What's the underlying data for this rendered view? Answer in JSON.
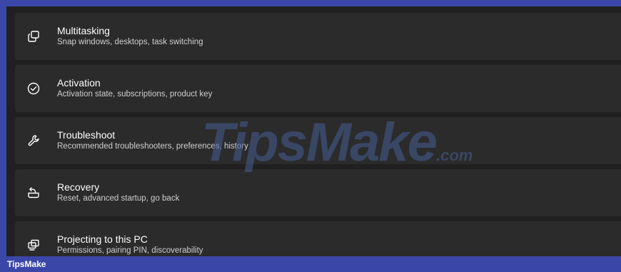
{
  "settings_items": [
    {
      "title": "Multitasking",
      "description": "Snap windows, desktops, task switching",
      "icon": "multitasking-icon"
    },
    {
      "title": "Activation",
      "description": "Activation state, subscriptions, product key",
      "icon": "check-circle-icon"
    },
    {
      "title": "Troubleshoot",
      "description": "Recommended troubleshooters, preferences, history",
      "icon": "wrench-icon"
    },
    {
      "title": "Recovery",
      "description": "Reset, advanced startup, go back",
      "icon": "recovery-icon"
    },
    {
      "title": "Projecting to this PC",
      "description": "Permissions, pairing PIN, discoverability",
      "icon": "projecting-icon"
    }
  ],
  "watermark": {
    "text": "TipsMake",
    "suffix": ".com"
  },
  "bottom_bar": {
    "label": "TipsMake"
  },
  "colors": {
    "accent": "#3b47a8",
    "background": "#202020",
    "card": "#2b2b2b"
  }
}
